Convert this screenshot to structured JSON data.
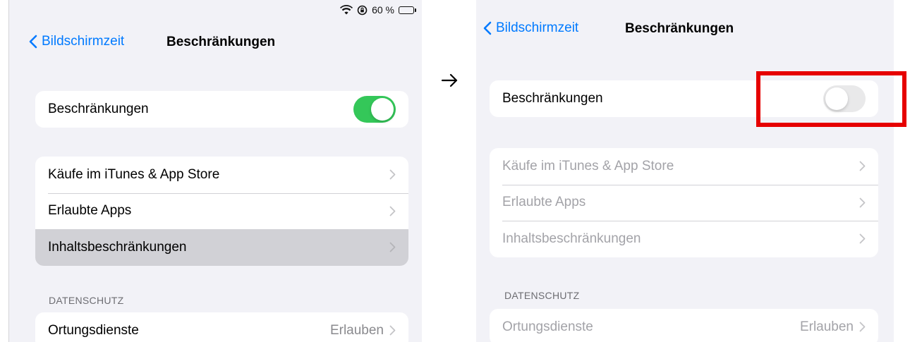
{
  "colors": {
    "accent": "#007aff",
    "toggle_on": "#34c759",
    "toggle_off": "#e9e9ea",
    "highlight": "#e60000"
  },
  "left": {
    "status": {
      "battery_percent": "60 %",
      "battery_level": 0.6
    },
    "nav": {
      "back_label": "Bildschirmzeit",
      "title": "Beschränkungen"
    },
    "toggle_row": {
      "label": "Beschränkungen",
      "state": "on"
    },
    "items": [
      {
        "label": "Käufe im iTunes & App Store"
      },
      {
        "label": "Erlaubte Apps"
      },
      {
        "label": "Inhaltsbeschränkungen",
        "highlighted": true
      }
    ],
    "privacy": {
      "header": "DATENSCHUTZ",
      "rows": [
        {
          "label": "Ortungsdienste",
          "value": "Erlauben"
        }
      ]
    }
  },
  "right": {
    "nav": {
      "back_label": "Bildschirmzeit",
      "title": "Beschränkungen"
    },
    "toggle_row": {
      "label": "Beschränkungen",
      "state": "off"
    },
    "items": [
      {
        "label": "Käufe im iTunes & App Store",
        "disabled": true
      },
      {
        "label": "Erlaubte Apps",
        "disabled": true
      },
      {
        "label": "Inhaltsbeschränkungen",
        "disabled": true
      }
    ],
    "privacy": {
      "header": "DATENSCHUTZ",
      "rows": [
        {
          "label": "Ortungsdienste",
          "value": "Erlauben",
          "disabled": true
        }
      ]
    }
  },
  "icons": {
    "arrow": "right-arrow-icon",
    "back": "chevron-left-icon",
    "row": "chevron-right-icon",
    "wifi": "wifi-icon",
    "lock": "orientation-lock-icon",
    "battery": "battery-icon"
  }
}
